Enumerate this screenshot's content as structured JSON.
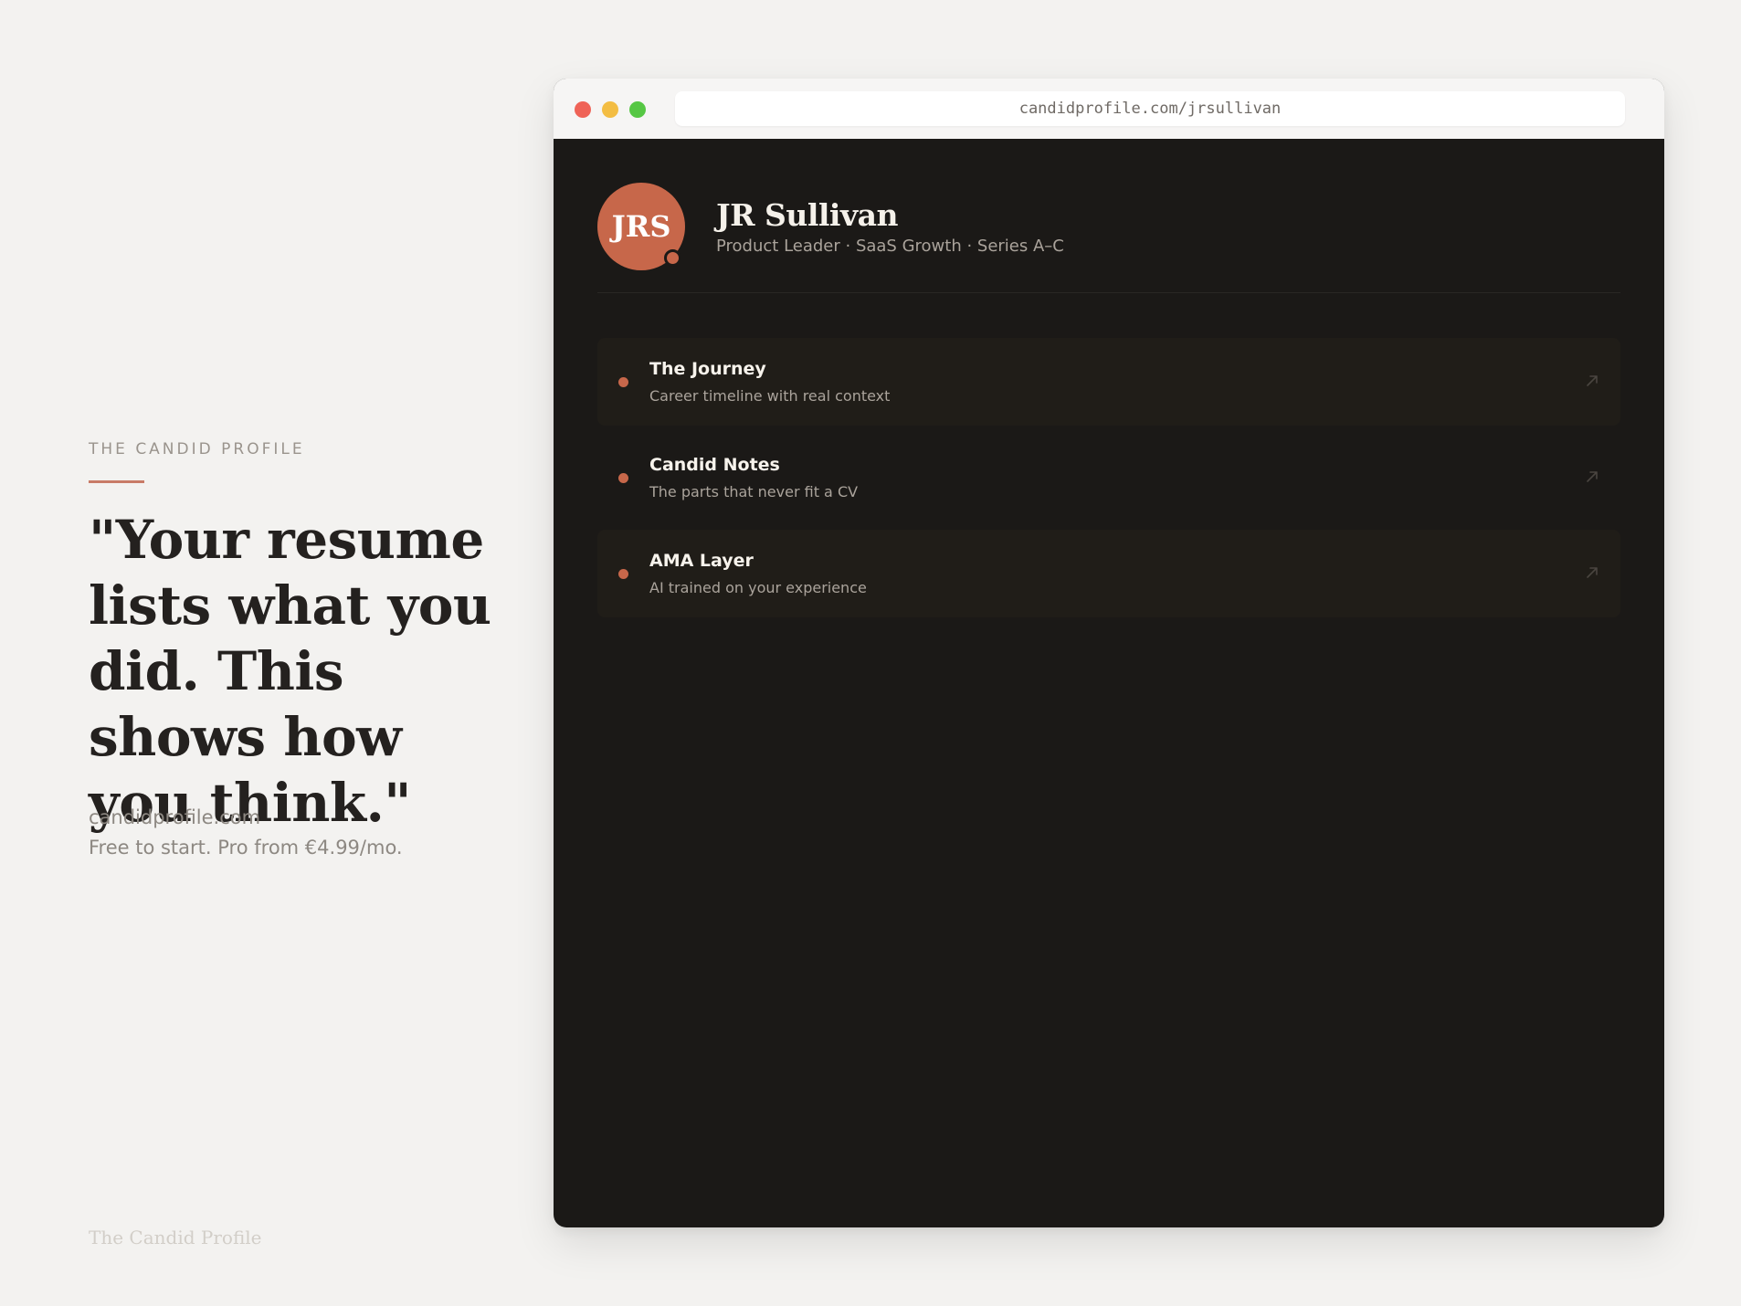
{
  "promo": {
    "eyebrow": "THE CANDID PROFILE",
    "quote": "\"Your resume lists what you did. This shows how you think.\"",
    "site": "candidprofile.com",
    "pricing": "Free to start. Pro from €4.99/mo.",
    "footer": "The Candid Profile"
  },
  "browser": {
    "url": "candidprofile.com/jrsullivan"
  },
  "profile": {
    "initials": "JRS",
    "name": "JR Sullivan",
    "tagline": "Product Leader · SaaS Growth · Series A–C"
  },
  "links": [
    {
      "title": "The Journey",
      "subtitle": "Career timeline with real context",
      "icon": "arrow-up-right-icon"
    },
    {
      "title": "Candid Notes",
      "subtitle": "The parts that never fit a CV",
      "icon": "arrow-up-right-icon"
    },
    {
      "title": "AMA Layer",
      "subtitle": "AI trained on your experience",
      "icon": "arrow-up-right-icon"
    }
  ],
  "colors": {
    "accent": "#c7674a",
    "page_background": "#f3f2f0",
    "app_background": "#1b1917",
    "card_background": "#201d18"
  }
}
